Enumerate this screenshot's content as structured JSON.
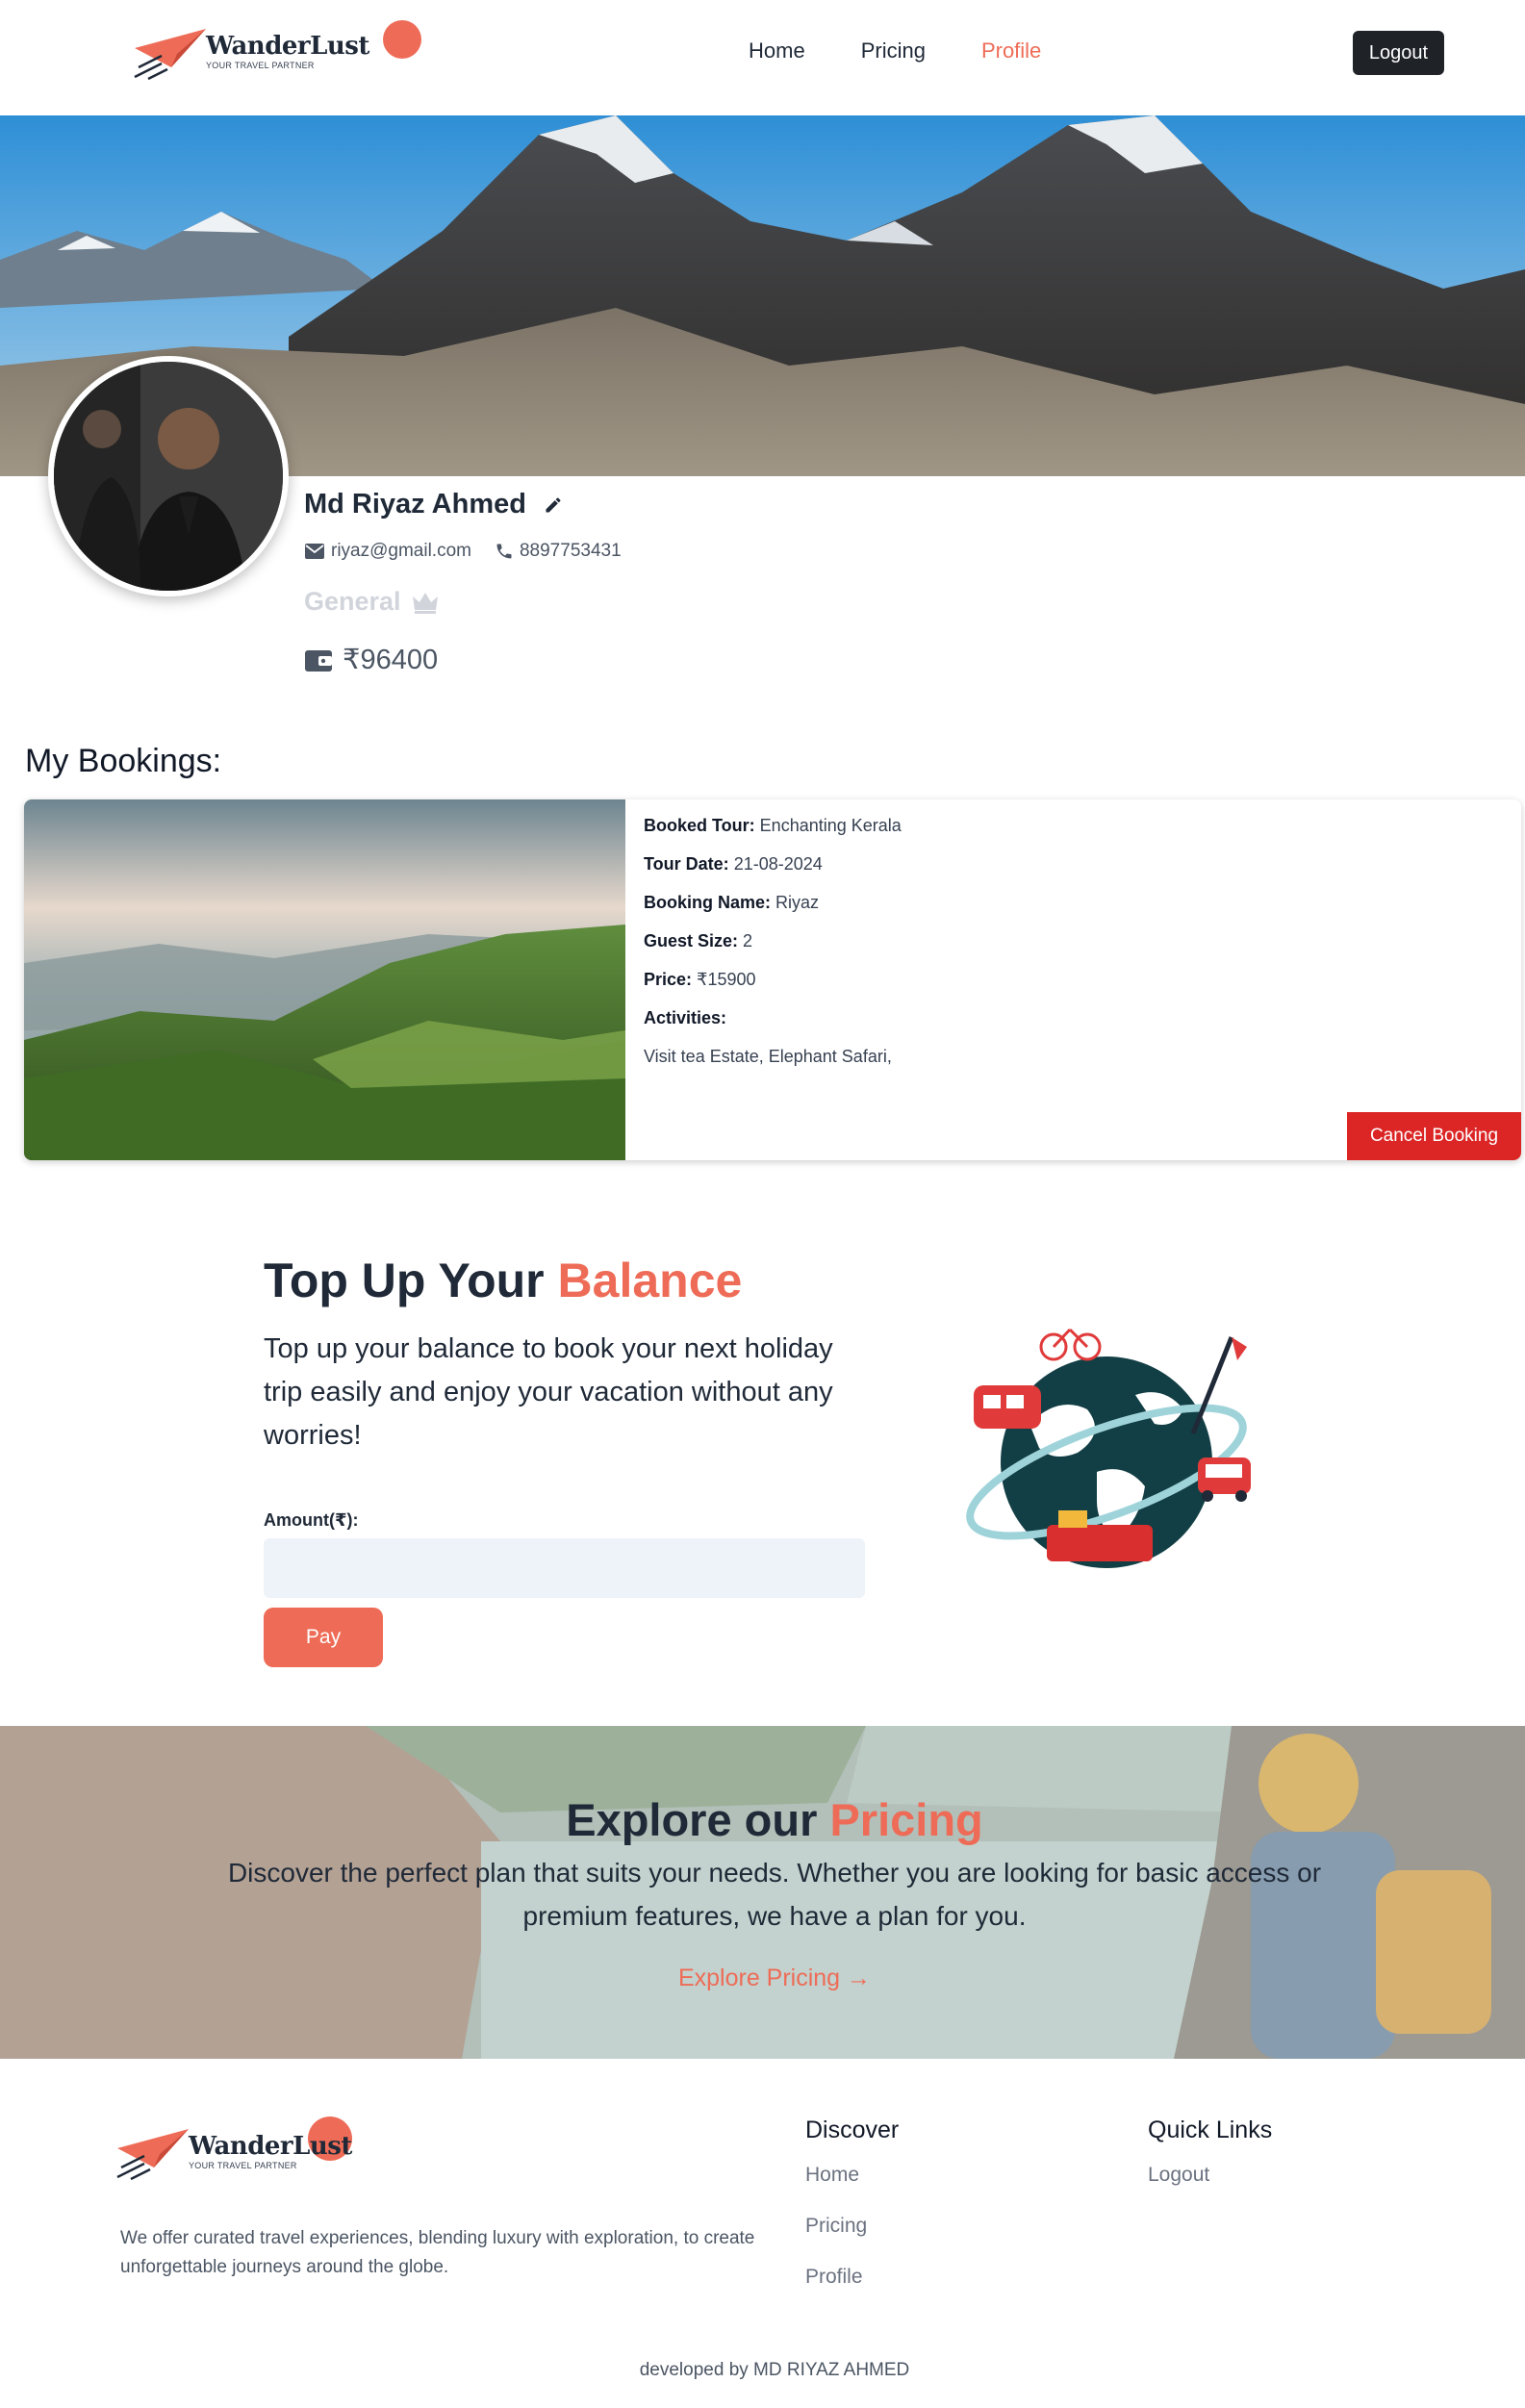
{
  "brand": {
    "name": "WanderLust",
    "tagline": "YOUR TRAVEL PARTNER"
  },
  "nav": {
    "items": [
      {
        "label": "Home"
      },
      {
        "label": "Pricing"
      },
      {
        "label": "Profile"
      }
    ],
    "logout": "Logout"
  },
  "profile": {
    "name": "Md Riyaz Ahmed",
    "email": "riyaz@gmail.com",
    "phone": "8897753431",
    "plan": "General",
    "balance": "₹96400"
  },
  "bookings": {
    "title": "My Bookings:",
    "items": [
      {
        "tour_label": "Booked Tour:",
        "tour": "Enchanting Kerala",
        "date_label": "Tour Date:",
        "date": "21-08-2024",
        "name_label": "Booking Name:",
        "name": "Riyaz",
        "guests_label": "Guest Size:",
        "guests": "2",
        "price_label": "Price:",
        "price": "₹15900",
        "activities_label": "Activities:",
        "activities": "Visit tea Estate, Elephant Safari,",
        "cancel": "Cancel Booking"
      }
    ]
  },
  "topup": {
    "title_main": "Top Up Your",
    "title_accent": "Balance",
    "description": "Top up your balance to book your next holiday trip easily and enjoy your vacation without any worries!",
    "amount_label": "Amount(₹):",
    "amount_value": "",
    "pay": "Pay"
  },
  "explore": {
    "title_main": "Explore our",
    "title_accent": "Pricing",
    "description": "Discover the perfect plan that suits your needs. Whether you are looking for basic access or premium features, we have a plan for you.",
    "link": "Explore Pricing →"
  },
  "footer": {
    "description": "We offer curated travel experiences, blending luxury with exploration, to create unforgettable journeys around the globe.",
    "discover": {
      "title": "Discover",
      "links": [
        "Home",
        "Pricing",
        "Profile"
      ]
    },
    "quick": {
      "title": "Quick Links",
      "links": [
        "Logout"
      ]
    },
    "credit": "developed by MD RIYAZ AHMED"
  },
  "colors": {
    "accent": "#ee6c57",
    "dark_button": "#1f2328",
    "danger": "#dc2626",
    "input_bg": "#eef3fa"
  }
}
